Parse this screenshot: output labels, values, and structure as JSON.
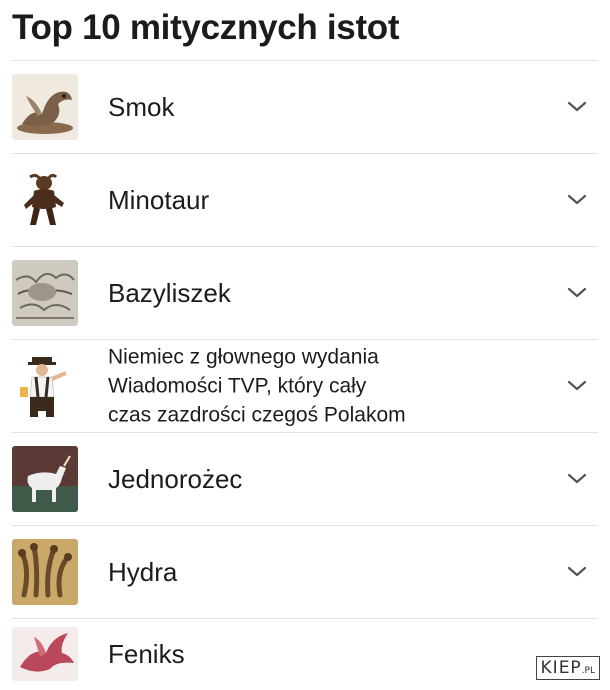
{
  "page": {
    "title": "Top 10 mitycznych istot"
  },
  "items": [
    {
      "label": "Smok",
      "icon": "dragon-icon"
    },
    {
      "label": "Minotaur",
      "icon": "minotaur-icon"
    },
    {
      "label": "Bazyliszek",
      "icon": "basilisk-icon"
    },
    {
      "label_lines": [
        "Niemiec z głownego wydania",
        "Wiadomości TVP, który cały",
        "czas zazdrości czegoś Polakom"
      ],
      "icon": "man-in-lederhosen-icon"
    },
    {
      "label": "Jednorożec",
      "icon": "unicorn-icon"
    },
    {
      "label": "Hydra",
      "icon": "hydra-icon"
    },
    {
      "label": "Feniks",
      "icon": "phoenix-icon"
    }
  ],
  "watermark": {
    "main": "KIEP",
    "suffix": ".PL"
  },
  "colors": {
    "divider": "#e3e3e3",
    "chevron": "#555555",
    "text": "#1c1c1c"
  }
}
